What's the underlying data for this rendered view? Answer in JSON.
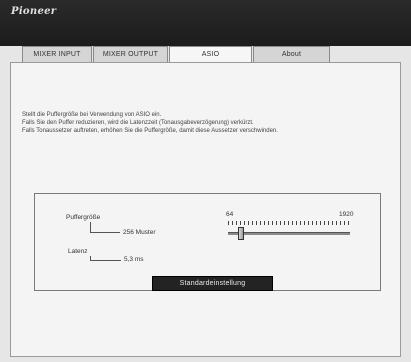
{
  "app": {
    "logo": "Pioneer"
  },
  "tabs": [
    {
      "label": "MIXER INPUT"
    },
    {
      "label": "MIXER OUTPUT"
    },
    {
      "label": "ASIO"
    },
    {
      "label": "About"
    }
  ],
  "active_tab": "ASIO",
  "description": {
    "line1": "Stellt die Puffergröße bei Verwendung von ASIO ein.",
    "line2": "Falls Sie den Puffer reduzieren, wird die Latenzzeit (Tonausgabeverzögerung) verkürzt.",
    "line3": "Falls Tonaussetzer auftreten, erhöhen Sie die Puffergröße, damit diese Aussetzer verschwinden."
  },
  "buffer": {
    "label": "Puffergröße",
    "value_text": "256 Muster",
    "slider_min_label": "64",
    "slider_max_label": "1920",
    "slider_min": 64,
    "slider_max": 1920,
    "slider_value": 256
  },
  "latency": {
    "label": "Latenz",
    "value_text": "5,3 ms"
  },
  "default_button": {
    "label": "Standardeinstellung"
  }
}
